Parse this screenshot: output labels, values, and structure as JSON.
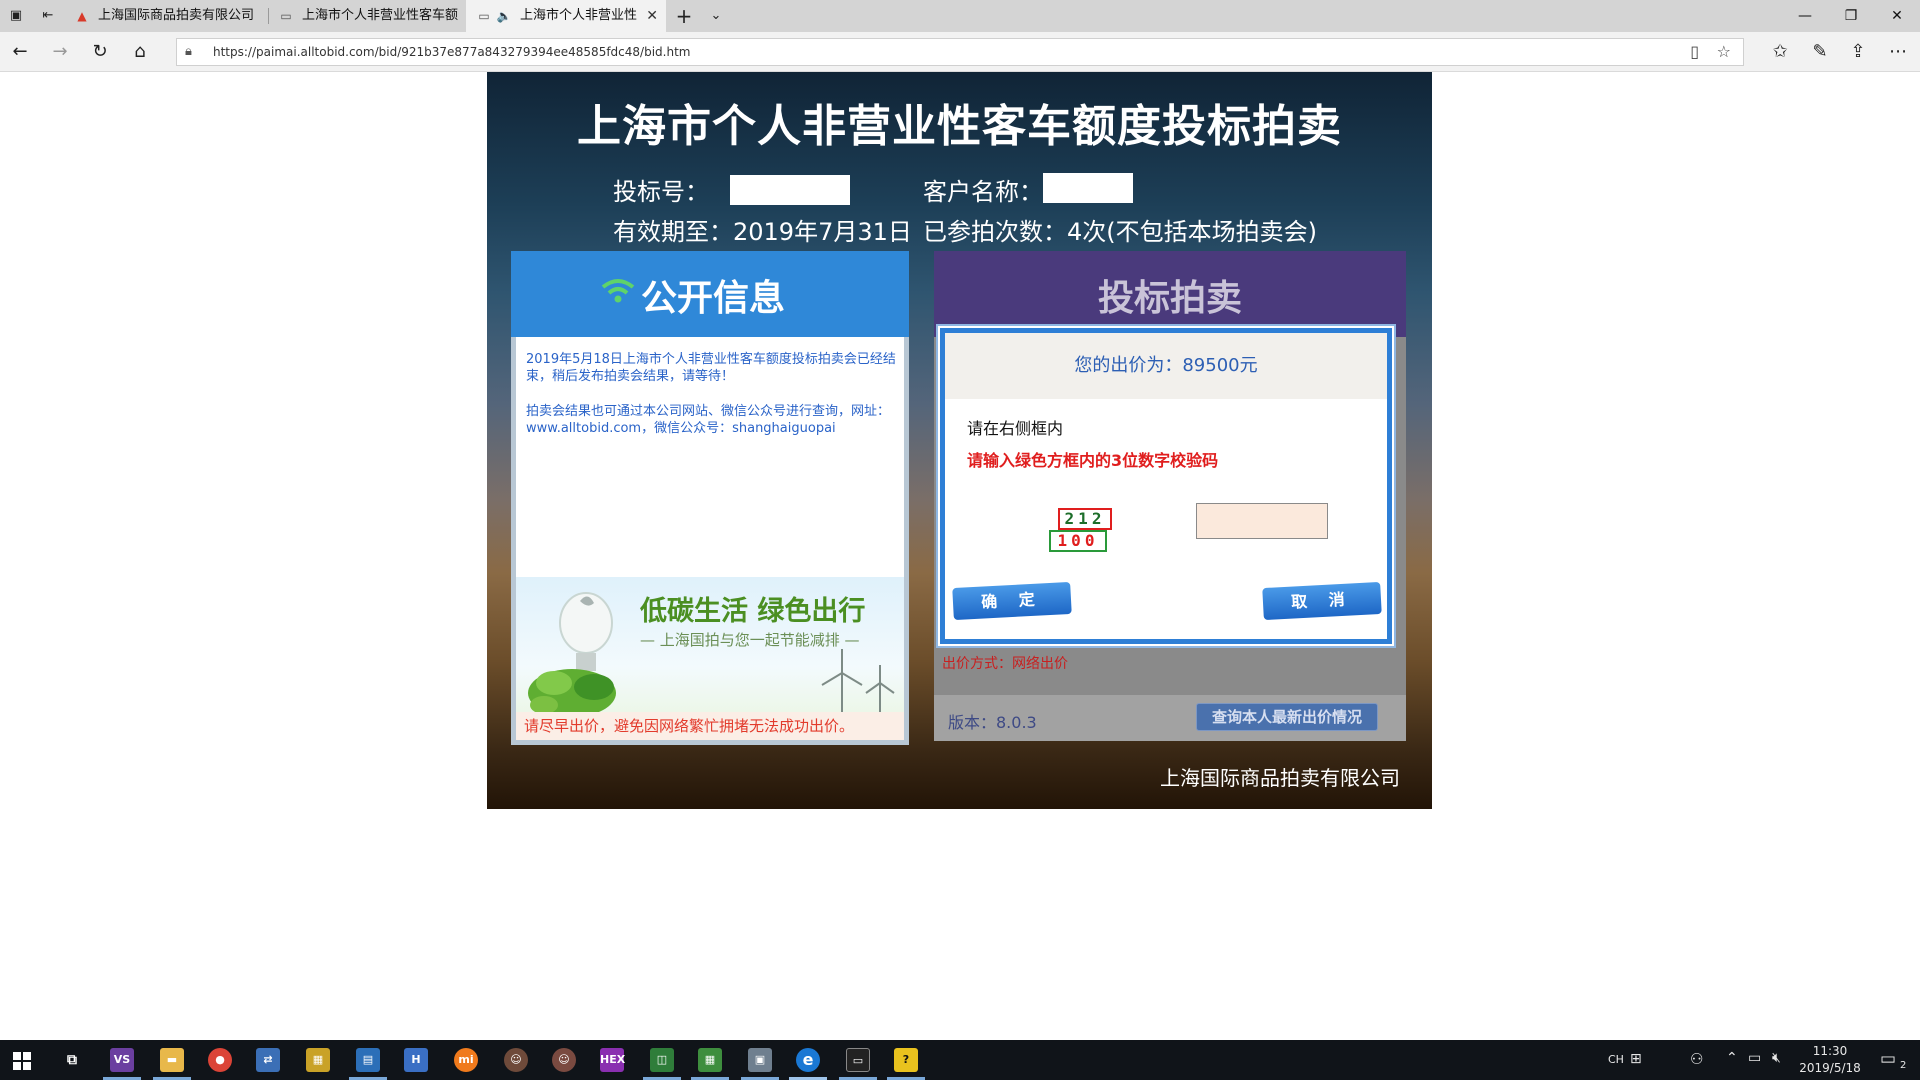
{
  "browser": {
    "tabs": [
      {
        "label": "上海国际商品拍卖有限公司",
        "icon": "alert-triangle-icon"
      },
      {
        "label": "上海市个人非营业性客车额",
        "icon": "page-icon"
      },
      {
        "label": "上海市个人非营业性",
        "icon": "page-icon",
        "active": true,
        "audio": true
      }
    ],
    "url": "https://paimai.alltobid.com/bid/921b37e877a843279394ee48585fdc48/bid.htm"
  },
  "page": {
    "title": "上海市个人非营业性客车额度投标拍卖",
    "bid_number_label": "投标号：",
    "customer_label": "客户名称：",
    "valid_until": "有效期至：2019年7月31日",
    "participations": "已参拍次数：4次(不包括本场拍卖会)",
    "left_panel": {
      "title": "公开信息",
      "notice1": "2019年5月18日上海市个人非营业性客车额度投标拍卖会已经结束，稍后发布拍卖会结果，请等待！",
      "notice2": "拍卖会结果也可通过本公司网站、微信公众号进行查询，网址：www.alltobid.com，微信公众号：shanghaiguopai",
      "banner_title": "低碳生活 绿色出行",
      "banner_sub": "— 上海国拍与您一起节能减排 —",
      "tip": "请尽早出价，避免因网络繁忙拥堵无法成功出价。"
    },
    "right_panel": {
      "title": "投标拍卖",
      "bid_method": "出价方式：网络出价",
      "version": "版本：8.0.3",
      "query_button": "查询本人最新出价情况"
    },
    "dialog": {
      "price": "您的出价为：89500元",
      "message1": "请在右侧框内",
      "message2": "请输入绿色方框内的3位数字校验码",
      "code_top": "212",
      "code_bottom": "100",
      "ok": "确 定",
      "cancel": "取 消"
    },
    "company": "上海国际商品拍卖有限公司"
  },
  "taskbar": {
    "ime": "CH",
    "time": "11:30",
    "date": "2019/5/18",
    "notification_count": "2"
  },
  "colors": {
    "left_header": "#2f88d8",
    "right_header": "#4a3a7c",
    "dialog_border": "#2e7fd6",
    "warning_red": "#e01e1e"
  }
}
